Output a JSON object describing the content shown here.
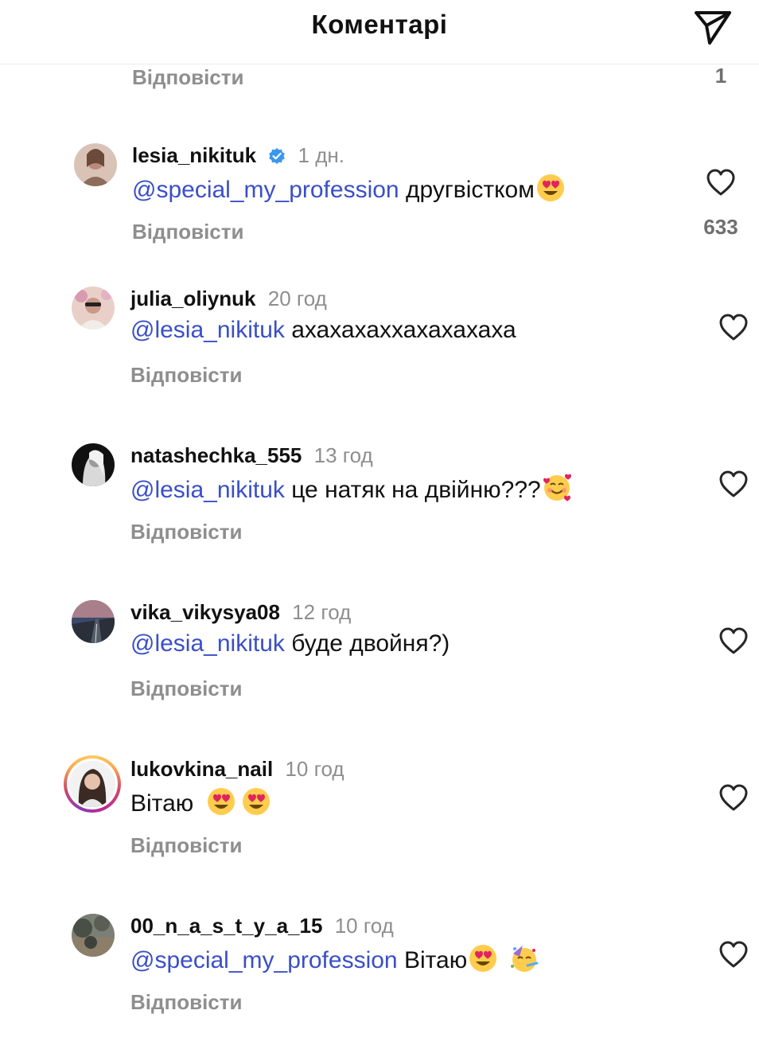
{
  "header": {
    "title": "Коментарі"
  },
  "top_partial": {
    "reply_label": "Відповісти",
    "like_count": "1"
  },
  "comments": [
    {
      "username": "lesia_nikituk",
      "verified": true,
      "time": "1 дн.",
      "mention": "@special_my_profession",
      "text": " другвістком",
      "emojis": [
        "heart-eyes"
      ],
      "reply_label": "Відповісти",
      "like_count": "633"
    },
    {
      "username": "julia_oliynuk",
      "verified": false,
      "time": "20 год",
      "mention": "@lesia_nikituk",
      "text": " ахахахаххахахахаха",
      "emojis": [],
      "reply_label": "Відповісти"
    },
    {
      "username": "natashechka_555",
      "verified": false,
      "time": "13 год",
      "mention": "@lesia_nikituk",
      "text": " це натяк на двійню???",
      "emojis": [
        "smiling-hearts"
      ],
      "reply_label": "Відповісти"
    },
    {
      "username": "vika_vikysya08",
      "verified": false,
      "time": "12 год",
      "mention": "@lesia_nikituk",
      "text": " буде двойня?)",
      "emojis": [],
      "reply_label": "Відповісти"
    },
    {
      "username": "lukovkina_nail",
      "verified": false,
      "time": "10 год",
      "mention": "",
      "text": "Вітаю ",
      "emojis": [
        "heart-eyes",
        "heart-eyes"
      ],
      "reply_label": "Відповісти",
      "has_story": true
    },
    {
      "username": "00_n_a_s_t_y_a_15",
      "verified": false,
      "time": "10 год",
      "mention": "@special_my_profession",
      "text": " Вітаю",
      "emojis": [
        "heart-eyes",
        "partying-face"
      ],
      "reply_label": "Відповісти"
    }
  ]
}
